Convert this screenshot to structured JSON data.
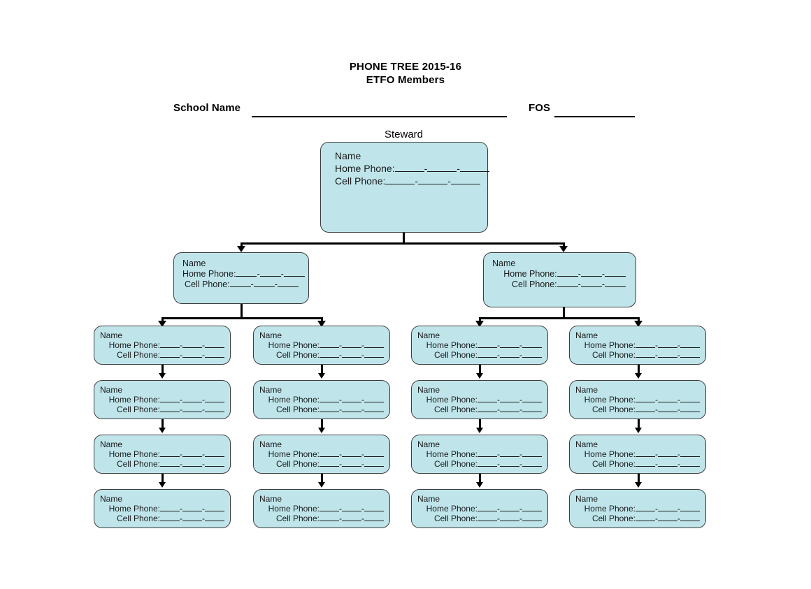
{
  "document": {
    "title_line1": "PHONE TREE 2015-16",
    "title_line2": "ETFO Members",
    "school_label": "School Name",
    "fos_label": "FOS"
  },
  "tree": {
    "root_label": "Steward",
    "fields": {
      "name": "Name",
      "home_phone": "Home Phone:",
      "cell_phone": "Cell Phone:"
    },
    "separator": "-",
    "levels": [
      {
        "level": 1,
        "nodes": [
          {
            "name": "Name",
            "home_phone": "Home Phone:",
            "cell_phone": "Cell Phone:"
          }
        ]
      },
      {
        "level": 2,
        "nodes": [
          {
            "name": "Name",
            "home_phone": "Home Phone:",
            "cell_phone": "Cell Phone:"
          },
          {
            "name": "Name",
            "home_phone": "Home Phone:",
            "cell_phone": "Cell Phone:"
          }
        ]
      },
      {
        "level": 3,
        "columns": [
          {
            "column": 1,
            "nodes": [
              {
                "name": "Name",
                "home_phone": "Home Phone:",
                "cell_phone": "Cell Phone:"
              },
              {
                "name": "Name",
                "home_phone": "Home Phone:",
                "cell_phone": "Cell Phone:"
              },
              {
                "name": "Name",
                "home_phone": "Home Phone:",
                "cell_phone": "Cell Phone:"
              },
              {
                "name": "Name",
                "home_phone": "Home Phone:",
                "cell_phone": "Cell Phone:"
              }
            ]
          },
          {
            "column": 2,
            "nodes": [
              {
                "name": "Name",
                "home_phone": "Home Phone:",
                "cell_phone": "Cell Phone:"
              },
              {
                "name": "Name",
                "home_phone": "Home Phone:",
                "cell_phone": "Cell Phone:"
              },
              {
                "name": "Name",
                "home_phone": "Home Phone:",
                "cell_phone": "Cell Phone:"
              },
              {
                "name": "Name",
                "home_phone": "Home Phone:",
                "cell_phone": "Cell Phone:"
              }
            ]
          },
          {
            "column": 3,
            "nodes": [
              {
                "name": "Name",
                "home_phone": "Home Phone:",
                "cell_phone": "Cell Phone:"
              },
              {
                "name": "Name",
                "home_phone": "Home Phone:",
                "cell_phone": "Cell Phone:"
              },
              {
                "name": "Name",
                "home_phone": "Home Phone:",
                "cell_phone": "Cell Phone:"
              },
              {
                "name": "Name",
                "home_phone": "Home Phone:",
                "cell_phone": "Cell Phone:"
              }
            ]
          },
          {
            "column": 4,
            "nodes": [
              {
                "name": "Name",
                "home_phone": "Home Phone:",
                "cell_phone": "Cell Phone:"
              },
              {
                "name": "Name",
                "home_phone": "Home Phone:",
                "cell_phone": "Cell Phone:"
              },
              {
                "name": "Name",
                "home_phone": "Home Phone:",
                "cell_phone": "Cell Phone:"
              },
              {
                "name": "Name",
                "home_phone": "Home Phone:",
                "cell_phone": "Cell Phone:"
              }
            ]
          }
        ]
      }
    ]
  },
  "colors": {
    "node_fill": "#bfe5eb",
    "node_border": "#3d3d3d",
    "connector": "#000000",
    "page_background": "#ffffff",
    "text": "#000000"
  }
}
